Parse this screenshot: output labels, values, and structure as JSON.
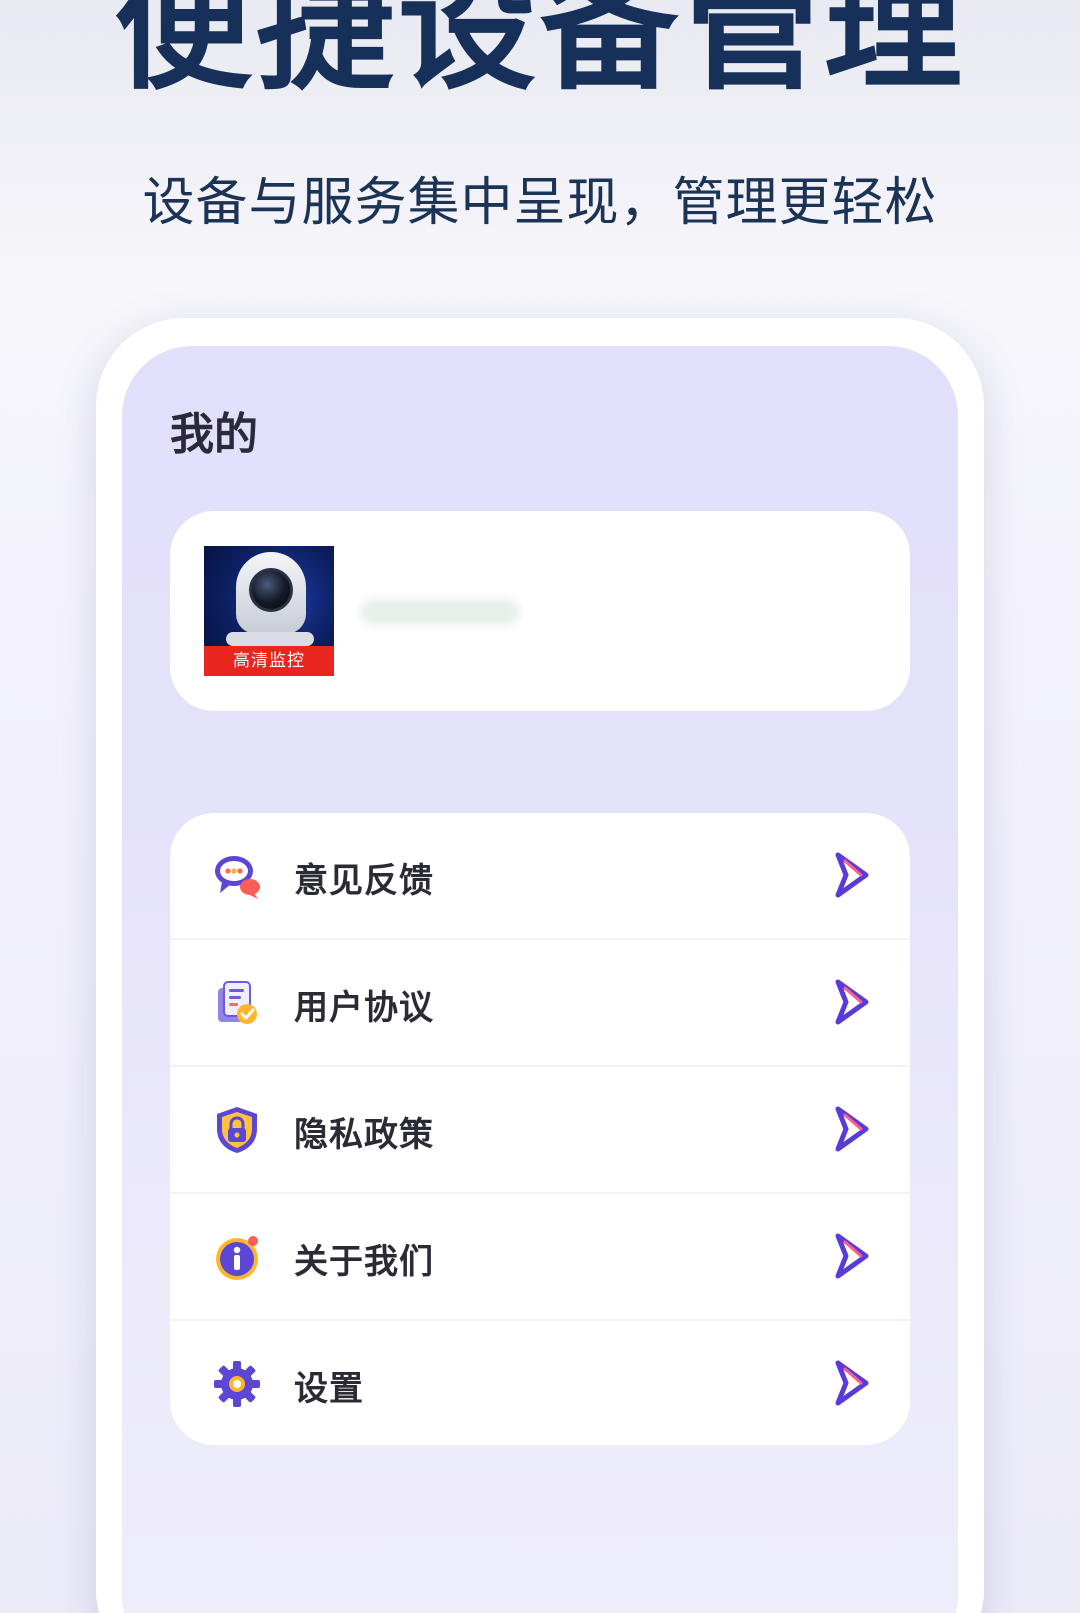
{
  "header": {
    "headline": "便捷设备管理",
    "subline": "设备与服务集中呈现，管理更轻松"
  },
  "page": {
    "title": "我的"
  },
  "profile": {
    "app_badge": "高清监控",
    "username": ""
  },
  "menu": {
    "items": [
      {
        "label": "意见反馈",
        "icon": "feedback-chat-icon"
      },
      {
        "label": "用户协议",
        "icon": "document-check-icon"
      },
      {
        "label": "隐私政策",
        "icon": "shield-lock-icon"
      },
      {
        "label": "关于我们",
        "icon": "info-icon"
      },
      {
        "label": "设置",
        "icon": "gear-icon"
      }
    ]
  },
  "colors": {
    "headline": "#17305a",
    "chevron": "#5a3bd8",
    "screen_bg": "#e2dffb",
    "badge_red": "#e8261f"
  }
}
